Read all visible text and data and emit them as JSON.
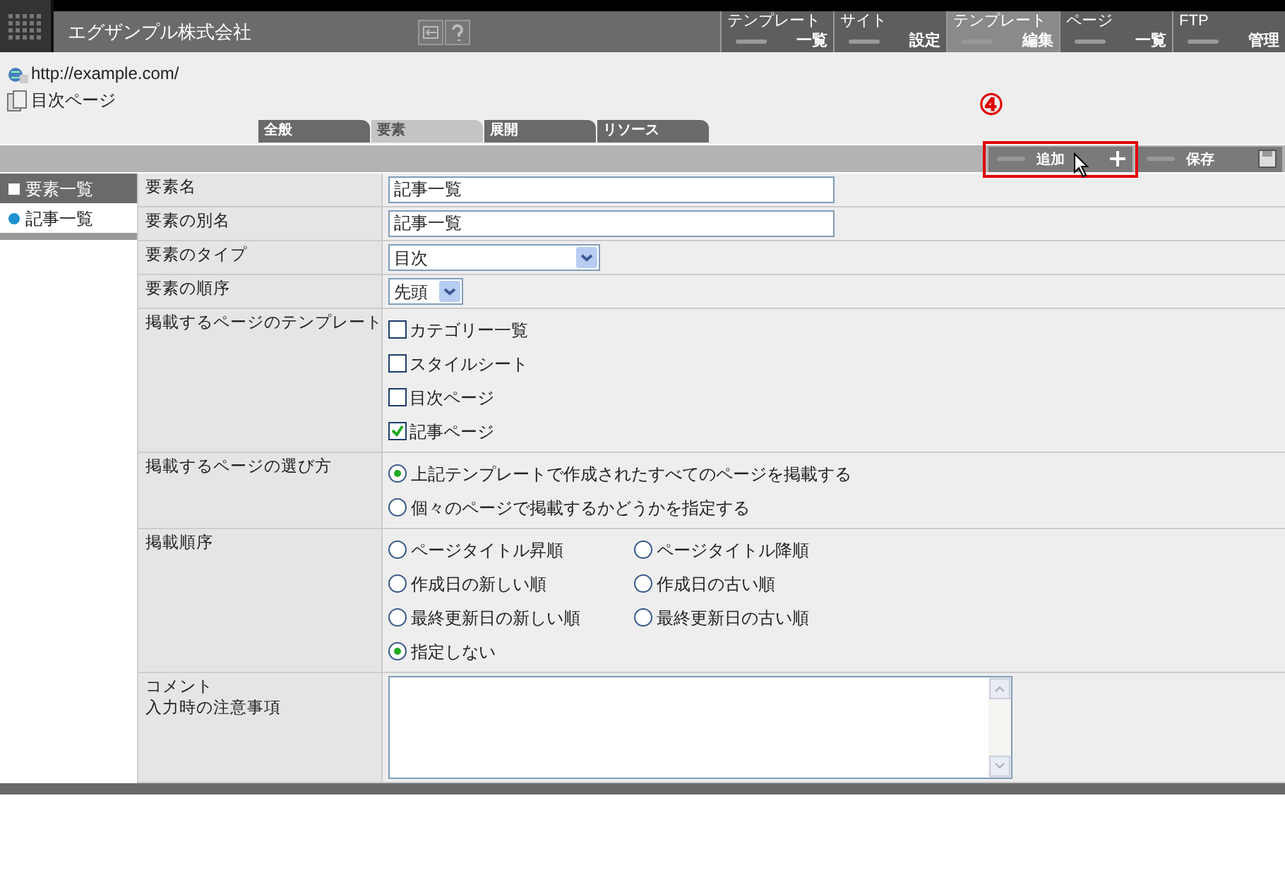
{
  "header": {
    "company": "エグザンプル株式会社"
  },
  "nav": [
    {
      "top": "テンプレート",
      "bottom": "一覧",
      "selected": false
    },
    {
      "top": "サイト",
      "bottom": "設定",
      "selected": false
    },
    {
      "top": "テンプレート",
      "bottom": "編集",
      "selected": true
    },
    {
      "top": "ページ",
      "bottom": "一覧",
      "selected": false
    },
    {
      "top": "FTP",
      "bottom": "管理",
      "selected": false
    }
  ],
  "site_url": "http://example.com/",
  "page_title": "目次ページ",
  "tabs": [
    {
      "label": "全般",
      "selected": false
    },
    {
      "label": "要素",
      "selected": true
    },
    {
      "label": "展開",
      "selected": false
    },
    {
      "label": "リソース",
      "selected": false
    }
  ],
  "annotation": "④",
  "toolbar": [
    {
      "label": "追加",
      "kind": "add",
      "highlighted": true
    },
    {
      "label": "保存",
      "kind": "save",
      "highlighted": false
    }
  ],
  "sidebar": {
    "items": [
      {
        "label": "要素一覧",
        "selected": true,
        "kind": "header"
      },
      {
        "label": "記事一覧",
        "selected": false,
        "kind": "item"
      }
    ]
  },
  "form": [
    {
      "label": "要素名",
      "kind": "text",
      "value": "記事一覧"
    },
    {
      "label": "要素の別名",
      "kind": "text",
      "value": "記事一覧"
    },
    {
      "label": "要素のタイプ",
      "kind": "select",
      "value": "目次",
      "wide": true
    },
    {
      "label": "要素の順序",
      "kind": "select",
      "value": "先頭",
      "wide": false
    },
    {
      "label": "掲載するページのテンプレート",
      "kind": "checkboxes",
      "options": [
        {
          "label": "カテゴリー一覧",
          "checked": false
        },
        {
          "label": "スタイルシート",
          "checked": false
        },
        {
          "label": "目次ページ",
          "checked": false
        },
        {
          "label": "記事ページ",
          "checked": true
        }
      ]
    },
    {
      "label": "掲載するページの選び方",
      "kind": "radios",
      "options": [
        {
          "label": "上記テンプレートで作成されたすべてのページを掲載する",
          "selected": true
        },
        {
          "label": "個々のページで掲載するかどうかを指定する",
          "selected": false
        }
      ]
    },
    {
      "label": "掲載順序",
      "kind": "radiogrid",
      "options": [
        {
          "label": "ページタイトル昇順",
          "selected": false
        },
        {
          "label": "ページタイトル降順",
          "selected": false
        },
        {
          "label": "作成日の新しい順",
          "selected": false
        },
        {
          "label": "作成日の古い順",
          "selected": false
        },
        {
          "label": "最終更新日の新しい順",
          "selected": false
        },
        {
          "label": "最終更新日の古い順",
          "selected": false
        },
        {
          "label": "指定しない",
          "selected": true
        }
      ]
    },
    {
      "label_lines": [
        "コメント",
        "入力時の注意事項"
      ],
      "kind": "textarea"
    }
  ]
}
